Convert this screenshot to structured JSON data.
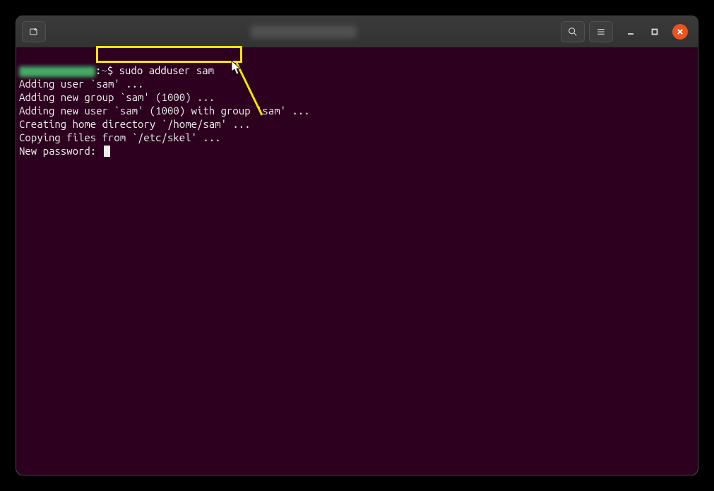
{
  "titlebar": {
    "newtab_tooltip": "New Tab",
    "search_tooltip": "Search",
    "menu_tooltip": "Menu",
    "minimize_tooltip": "Minimize",
    "maximize_tooltip": "Maximize",
    "close_tooltip": "Close"
  },
  "prompt": {
    "separator": ":",
    "cwd_sigil": "~",
    "dollar": "$ ",
    "command": "sudo adduser sam"
  },
  "output": {
    "line1": "Adding user `sam' ...",
    "line2": "Adding new group `sam' (1000) ...",
    "line3": "Adding new user `sam' (1000) with group `sam' ...",
    "line4": "Creating home directory `/home/sam' ...",
    "line5": "Copying files from `/etc/skel' ...",
    "line6": "New password: "
  },
  "annotation": {
    "highlight_target": "command-input"
  }
}
